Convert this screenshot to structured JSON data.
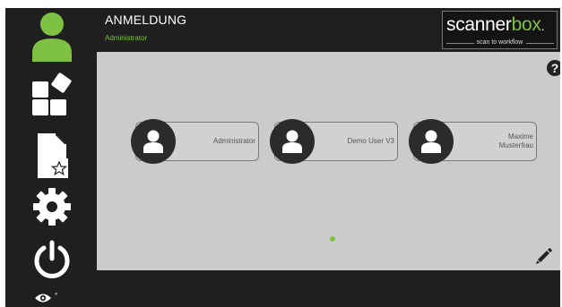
{
  "header": {
    "title": "ANMELDUNG",
    "subtitle": "Administrator"
  },
  "logo": {
    "word_part1": "scanner",
    "word_part2": "box",
    "trademark": ".",
    "tagline": "scan to workflow"
  },
  "sidebar": {
    "items": [
      {
        "icon": "user-icon"
      },
      {
        "icon": "apps-icon"
      },
      {
        "icon": "document-star-icon"
      },
      {
        "icon": "gear-icon"
      },
      {
        "icon": "power-icon"
      }
    ],
    "footer_icon": "eye-icon",
    "footer_indicator": "°"
  },
  "users": [
    {
      "name": "Administrator"
    },
    {
      "name": "Demo User V3"
    },
    {
      "name_line1": "Maxime",
      "name_line2": "Musterfrau"
    }
  ],
  "colors": {
    "accent": "#7fc243",
    "background": "#1f1f1f",
    "panel": "#cbcbcb"
  }
}
